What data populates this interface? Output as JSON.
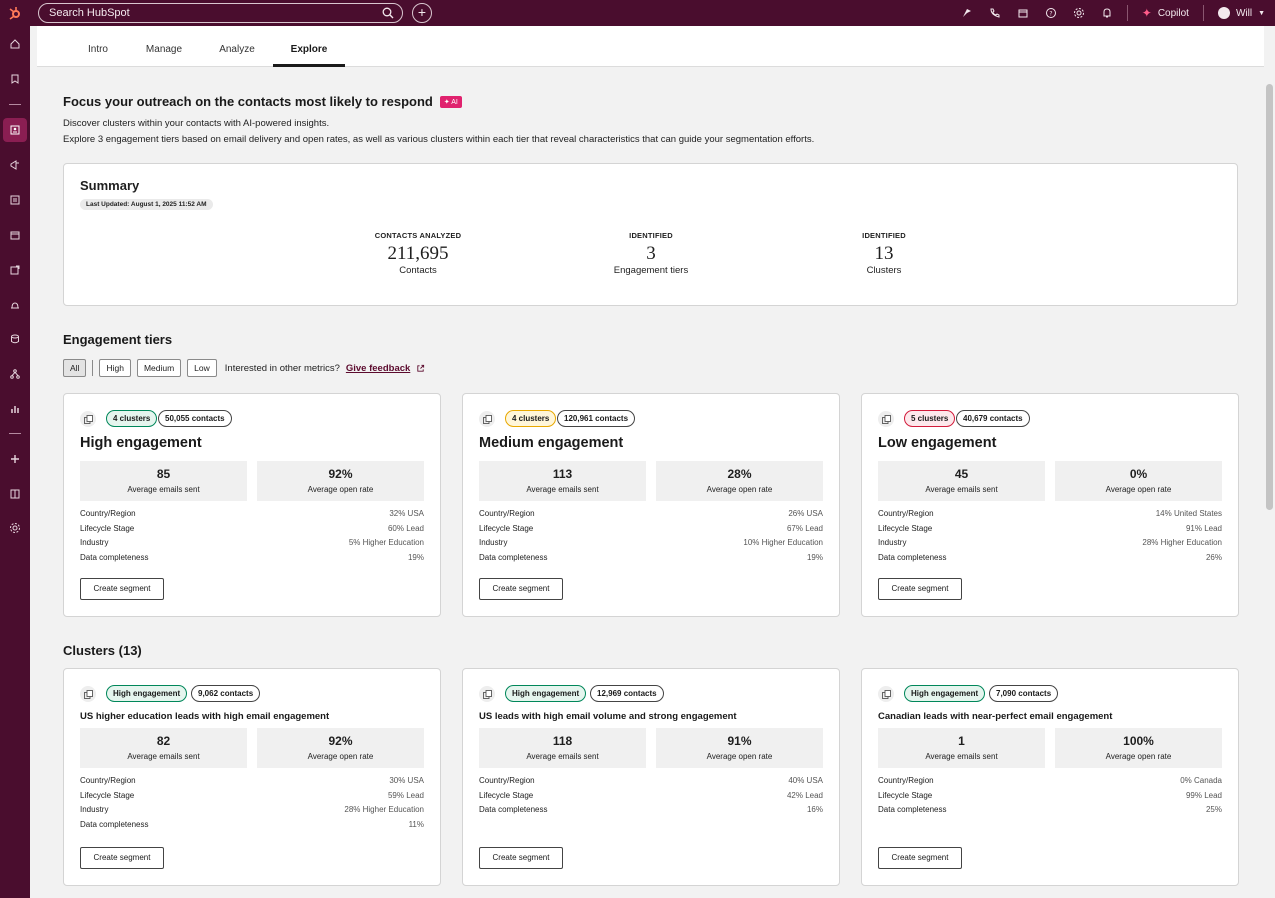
{
  "topbar": {
    "search_placeholder": "Search HubSpot",
    "copilot_label": "Copilot",
    "user_name": "Will",
    "icons": [
      "hubspot-logo-icon",
      "search-icon",
      "plus-icon",
      "upgrade-icon",
      "phone-icon",
      "marketplace-icon",
      "help-icon",
      "settings-icon",
      "notifications-icon",
      "copilot-spark-icon",
      "avatar",
      "chevron-down-icon"
    ]
  },
  "tabs": [
    {
      "label": "Intro"
    },
    {
      "label": "Manage"
    },
    {
      "label": "Analyze"
    },
    {
      "label": "Explore",
      "active": true
    }
  ],
  "hero": {
    "title": "Focus your outreach on the contacts most likely to respond",
    "ai_badge": "✦ AI",
    "line1": "Discover clusters within your contacts with AI-powered insights.",
    "line2": "Explore 3 engagement tiers based on email delivery and open rates, as well as various clusters within each tier that reveal characteristics that can guide your segmentation efforts."
  },
  "summary": {
    "title": "Summary",
    "updated": "Last Updated: August 1, 2025 11:52 AM",
    "stats": [
      {
        "label": "CONTACTS ANALYZED",
        "value": "211,695",
        "sub": "Contacts"
      },
      {
        "label": "IDENTIFIED",
        "value": "3",
        "sub": "Engagement tiers"
      },
      {
        "label": "IDENTIFIED",
        "value": "13",
        "sub": "Clusters"
      }
    ]
  },
  "tiers_section": {
    "title": "Engagement tiers",
    "filters": [
      "All",
      "High",
      "Medium",
      "Low"
    ],
    "selected_filter": "All",
    "feedback_prompt": "Interested in other metrics?",
    "feedback_link": "Give feedback"
  },
  "tiers": [
    {
      "badge": "4 clusters",
      "badge_color": "#00875a",
      "contacts": "50,055 contacts",
      "title": "High engagement",
      "m1_value": "85",
      "m1_label": "Average emails sent",
      "m2_value": "92%",
      "m2_label": "Average open rate",
      "attrs": [
        [
          "Country/Region",
          "32% USA"
        ],
        [
          "Lifecycle Stage",
          "60% Lead"
        ],
        [
          "Industry",
          "5% Higher Education"
        ],
        [
          "Data completeness",
          "19%"
        ]
      ],
      "button": "Create segment"
    },
    {
      "badge": "4 clusters",
      "badge_color": "#e8a800",
      "contacts": "120,961 contacts",
      "title": "Medium engagement",
      "m1_value": "113",
      "m1_label": "Average emails sent",
      "m2_value": "28%",
      "m2_label": "Average open rate",
      "attrs": [
        [
          "Country/Region",
          "26% USA"
        ],
        [
          "Lifecycle Stage",
          "67% Lead"
        ],
        [
          "Industry",
          "10% Higher Education"
        ],
        [
          "Data completeness",
          "19%"
        ]
      ],
      "button": "Create segment"
    },
    {
      "badge": "5 clusters",
      "badge_color": "#d21b3b",
      "contacts": "40,679 contacts",
      "title": "Low engagement",
      "m1_value": "45",
      "m1_label": "Average emails sent",
      "m2_value": "0%",
      "m2_label": "Average open rate",
      "attrs": [
        [
          "Country/Region",
          "14% United States"
        ],
        [
          "Lifecycle Stage",
          "91% Lead"
        ],
        [
          "Industry",
          "28% Higher Education"
        ],
        [
          "Data completeness",
          "26%"
        ]
      ],
      "button": "Create segment"
    }
  ],
  "clusters_section": {
    "title": "Clusters (13)"
  },
  "clusters": [
    {
      "badge": "High engagement",
      "contacts": "9,062 contacts",
      "title": "US higher education leads with high email engagement",
      "m1_value": "82",
      "m1_label": "Average emails sent",
      "m2_value": "92%",
      "m2_label": "Average open rate",
      "attrs": [
        [
          "Country/Region",
          "30% USA"
        ],
        [
          "Lifecycle Stage",
          "59% Lead"
        ],
        [
          "Industry",
          "28% Higher Education"
        ],
        [
          "Data completeness",
          "11%"
        ]
      ],
      "button": "Create segment"
    },
    {
      "badge": "High engagement",
      "contacts": "12,969 contacts",
      "title": "US leads with high email volume and strong engagement",
      "m1_value": "118",
      "m1_label": "Average emails sent",
      "m2_value": "91%",
      "m2_label": "Average open rate",
      "attrs": [
        [
          "Country/Region",
          "40% USA"
        ],
        [
          "Lifecycle Stage",
          "42% Lead"
        ],
        [
          "Data completeness",
          "16%"
        ]
      ],
      "button": "Create segment"
    },
    {
      "badge": "High engagement",
      "contacts": "7,090 contacts",
      "title": "Canadian leads with near-perfect email engagement",
      "m1_value": "1",
      "m1_label": "Average emails sent",
      "m2_value": "100%",
      "m2_label": "Average open rate",
      "attrs": [
        [
          "Country/Region",
          "0% Canada"
        ],
        [
          "Lifecycle Stage",
          "99% Lead"
        ],
        [
          "Data completeness",
          "25%"
        ]
      ],
      "button": "Create segment"
    }
  ]
}
